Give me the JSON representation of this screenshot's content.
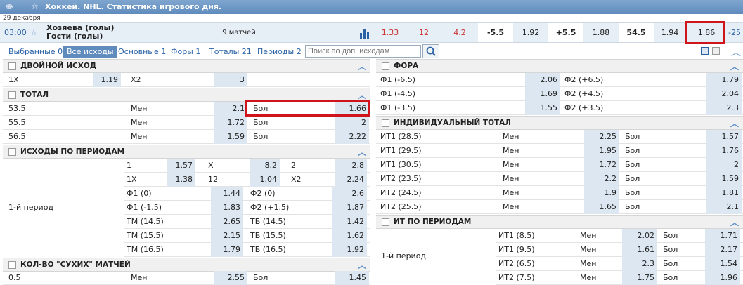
{
  "header": {
    "title": "Хоккей. NHL. Статистика игрового дня.",
    "date": "29 декабря"
  },
  "event": {
    "time": "03:00",
    "team1": "Хозяева (голы)",
    "team2": "Гости (голы)",
    "matches": "9 матчей",
    "odds": [
      "1.33",
      "12",
      "4.2"
    ],
    "hcp1": "-5.5",
    "hcp1_odd": "1.92",
    "hcp2": "+5.5",
    "hcp2_odd": "1.88",
    "total": "54.5",
    "total_under": "1.94",
    "total_over": "1.86",
    "more": "-25"
  },
  "tabs": [
    {
      "label": "Выбранные 0"
    },
    {
      "label": "Все исходы"
    },
    {
      "label": "Основные 1"
    },
    {
      "label": "Форы 1"
    },
    {
      "label": "Тоталы 21"
    },
    {
      "label": "Периоды 2"
    }
  ],
  "search": {
    "placeholder": "Поиск по доп. исходам"
  },
  "left": {
    "double": {
      "title": "ДВОЙНОЙ ИСХОД",
      "rows": [
        [
          "1X",
          "1.19",
          "X2",
          "3"
        ]
      ]
    },
    "total": {
      "title": "ТОТАЛ",
      "rows": [
        [
          "53.5",
          "Мен",
          "2.1",
          "Бол",
          "1.66"
        ],
        [
          "55.5",
          "Мен",
          "1.72",
          "Бол",
          "2"
        ],
        [
          "56.5",
          "Мен",
          "1.59",
          "Бол",
          "2.22"
        ]
      ]
    },
    "periods": {
      "title": "ИСХОДЫ ПО ПЕРИОДАМ",
      "period_label": "1-й период",
      "rows3": [
        [
          "1",
          "1.57",
          "X",
          "8.2",
          "2",
          "2.8"
        ],
        [
          "1X",
          "1.38",
          "12",
          "1.04",
          "X2",
          "2.24"
        ]
      ],
      "rows2": [
        [
          "Ф1 (0)",
          "1.44",
          "Ф2 (0)",
          "2.6"
        ],
        [
          "Ф1 (-1.5)",
          "1.83",
          "Ф2 (+1.5)",
          "1.87"
        ],
        [
          "ТМ (14.5)",
          "2.65",
          "ТБ (14.5)",
          "1.42"
        ],
        [
          "ТМ (15.5)",
          "2.15",
          "ТБ (15.5)",
          "1.62"
        ],
        [
          "ТМ (16.5)",
          "1.79",
          "ТБ (16.5)",
          "1.92"
        ]
      ]
    },
    "dry": {
      "title": "КОЛ-ВО \"СУХИХ\" МАТЧЕЙ",
      "rows": [
        [
          "0.5",
          "Мен",
          "2.55",
          "Бол",
          "1.45"
        ]
      ]
    }
  },
  "right": {
    "fora": {
      "title": "ФОРА",
      "rows": [
        [
          "Ф1 (-6.5)",
          "2.06",
          "Ф2 (+6.5)",
          "1.79"
        ],
        [
          "Ф1 (-4.5)",
          "1.69",
          "Ф2 (+4.5)",
          "2.04"
        ],
        [
          "Ф1 (-3.5)",
          "1.55",
          "Ф2 (+3.5)",
          "2.3"
        ]
      ]
    },
    "indiv": {
      "title": "ИНДИВИДУАЛЬНЫЙ ТОТАЛ",
      "rows": [
        [
          "ИТ1 (28.5)",
          "Мен",
          "2.25",
          "Бол",
          "1.57"
        ],
        [
          "ИТ1 (29.5)",
          "Мен",
          "1.95",
          "Бол",
          "1.76"
        ],
        [
          "ИТ1 (30.5)",
          "Мен",
          "1.72",
          "Бол",
          "2"
        ],
        [
          "ИТ2 (23.5)",
          "Мен",
          "2.2",
          "Бол",
          "1.59"
        ],
        [
          "ИТ2 (24.5)",
          "Мен",
          "1.9",
          "Бол",
          "1.81"
        ],
        [
          "ИТ2 (25.5)",
          "Мен",
          "1.65",
          "Бол",
          "2.1"
        ]
      ]
    },
    "itper": {
      "title": "ИТ ПО ПЕРИОДАМ",
      "period_label": "1-й период",
      "rows": [
        [
          "ИТ1 (8.5)",
          "Мен",
          "2.02",
          "Бол",
          "1.71"
        ],
        [
          "ИТ1 (9.5)",
          "Мен",
          "1.61",
          "Бол",
          "2.17"
        ],
        [
          "ИТ2 (6.5)",
          "Мен",
          "2.3",
          "Бол",
          "1.54"
        ],
        [
          "ИТ2 (7.5)",
          "Мен",
          "1.75",
          "Бол",
          "1.96"
        ]
      ]
    }
  },
  "colors": {
    "accent": "#5f8bbd",
    "highlight": "#d0141c",
    "red_odds": "#c33"
  }
}
